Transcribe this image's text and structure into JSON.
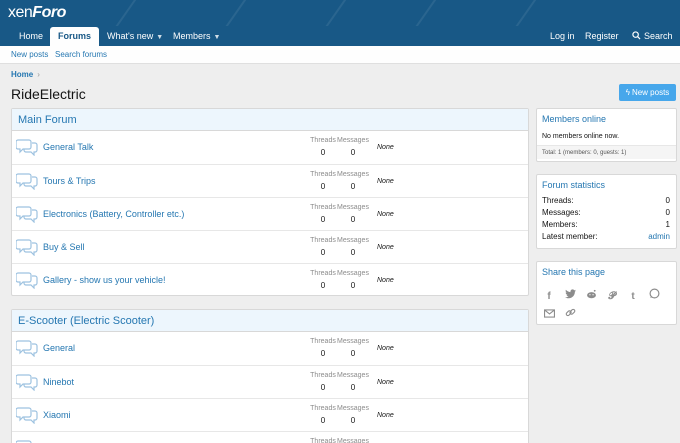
{
  "header": {
    "logo_part1": "xen",
    "logo_part2": "Foro"
  },
  "nav": {
    "tabs": [
      {
        "label": "Home"
      },
      {
        "label": "Forums"
      },
      {
        "label": "What's new"
      },
      {
        "label": "Members"
      }
    ],
    "login": "Log in",
    "register": "Register",
    "search": "Search"
  },
  "subnav": {
    "new_posts": "New posts",
    "search_forums": "Search forums"
  },
  "breadcrumb": {
    "home": "Home"
  },
  "page": {
    "title": "RideElectric",
    "new_posts_button": "New posts"
  },
  "forums": [
    {
      "title": "Main Forum",
      "nodes": [
        {
          "title": "General Talk",
          "threads": "0",
          "messages": "0",
          "latest": "None"
        },
        {
          "title": "Tours & Trips",
          "threads": "0",
          "messages": "0",
          "latest": "None"
        },
        {
          "title": "Electronics (Battery, Controller etc.)",
          "threads": "0",
          "messages": "0",
          "latest": "None"
        },
        {
          "title": "Buy & Sell",
          "threads": "0",
          "messages": "0",
          "latest": "None"
        },
        {
          "title": "Gallery - show us your vehicle!",
          "threads": "0",
          "messages": "0",
          "latest": "None"
        }
      ]
    },
    {
      "title": "E-Scooter (Electric Scooter)",
      "nodes": [
        {
          "title": "General",
          "threads": "0",
          "messages": "0",
          "latest": "None"
        },
        {
          "title": "Ninebot",
          "threads": "0",
          "messages": "0",
          "latest": "None"
        },
        {
          "title": "Xiaomi",
          "threads": "0",
          "messages": "0",
          "latest": "None"
        },
        {
          "title": "",
          "threads": "",
          "messages": "",
          "latest": ""
        }
      ]
    }
  ],
  "labels": {
    "threads": "Threads",
    "messages": "Messages"
  },
  "sidebar": {
    "members_online": {
      "title": "Members online",
      "body": "No members online now.",
      "footer": "Total: 1 (members: 0, guests: 1)"
    },
    "forum_statistics": {
      "title": "Forum statistics",
      "rows": [
        {
          "label": "Threads:",
          "value": "0"
        },
        {
          "label": "Messages:",
          "value": "0"
        },
        {
          "label": "Members:",
          "value": "1"
        },
        {
          "label": "Latest member:",
          "value": "admin"
        }
      ]
    },
    "share": {
      "title": "Share this page",
      "icons": [
        "facebook-icon",
        "twitter-icon",
        "reddit-icon",
        "pinterest-icon",
        "tumblr-icon",
        "whatsapp-icon",
        "email-icon",
        "link-icon"
      ]
    }
  },
  "colors": {
    "header": "#185886",
    "link": "#2577b1",
    "button": "#47a7eb",
    "block_header_bg": "#edf6fd"
  }
}
